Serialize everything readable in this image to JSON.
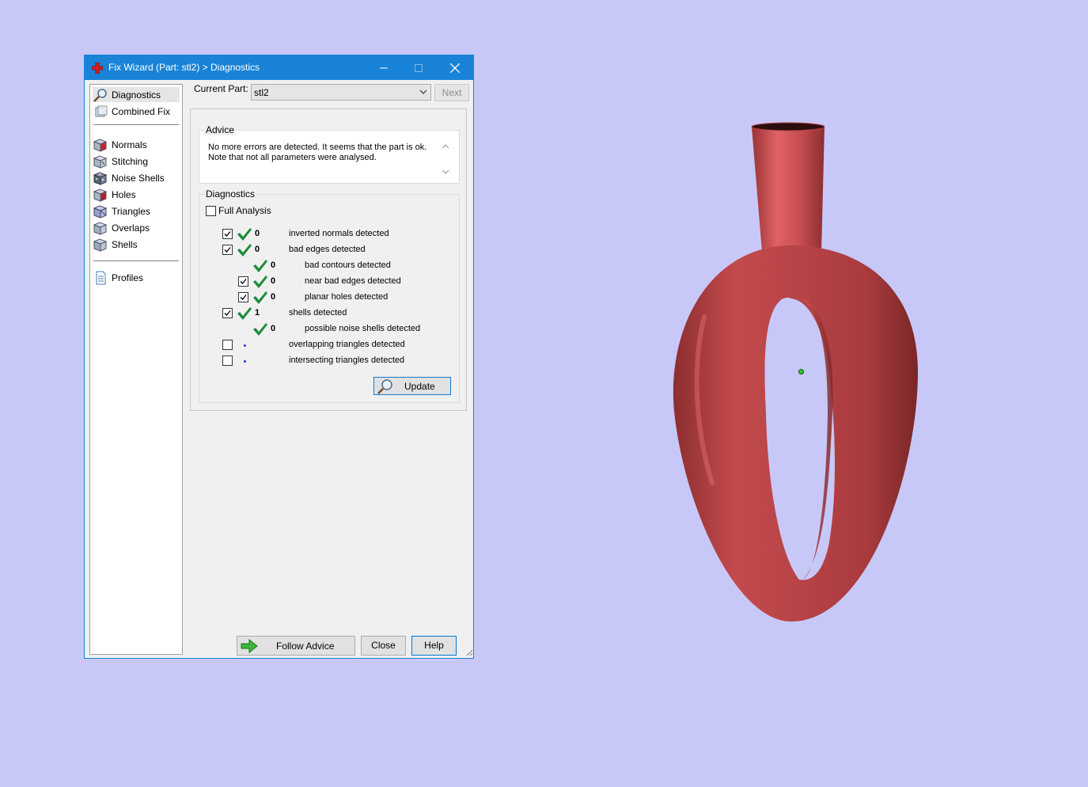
{
  "window": {
    "title": "Fix Wizard (Part: stl2) > Diagnostics",
    "accent_color": "#1883d7",
    "icons": [
      "app-cross-icon",
      "minimize-icon",
      "maximize-icon",
      "close-icon"
    ]
  },
  "sidebar": {
    "items": [
      {
        "label": "Diagnostics",
        "icon": "magnifier-icon",
        "selected": true
      },
      {
        "label": "Combined Fix",
        "icon": "cube-stack-icon"
      },
      {
        "label": "Normals",
        "icon": "normals-cube-icon"
      },
      {
        "label": "Stitching",
        "icon": "stitching-cube-icon"
      },
      {
        "label": "Noise Shells",
        "icon": "noise-shells-icon"
      },
      {
        "label": "Holes",
        "icon": "holes-cube-icon"
      },
      {
        "label": "Triangles",
        "icon": "triangles-cube-icon"
      },
      {
        "label": "Overlaps",
        "icon": "overlaps-cube-icon"
      },
      {
        "label": "Shells",
        "icon": "shells-cube-icon"
      },
      {
        "label": "Profiles",
        "icon": "document-icon"
      }
    ]
  },
  "current_part": {
    "label": "Current Part:",
    "value": "stl2",
    "next_label": "Next"
  },
  "advice": {
    "title": "Advice",
    "line1": "No more errors are detected. It seems that the part is ok.",
    "line2": "Note that not all parameters were analysed."
  },
  "diagnostics": {
    "title": "Diagnostics",
    "full_analysis_label": "Full Analysis",
    "full_analysis_checked": false,
    "rows": [
      {
        "checkbox": true,
        "checked": true,
        "status": "ok",
        "count": "0",
        "label": "inverted normals detected",
        "indent": 0
      },
      {
        "checkbox": true,
        "checked": true,
        "status": "ok",
        "count": "0",
        "label": "bad edges detected",
        "indent": 0
      },
      {
        "checkbox": false,
        "checked": false,
        "status": "ok",
        "count": "0",
        "label": "bad contours detected",
        "indent": 1
      },
      {
        "checkbox": true,
        "checked": true,
        "status": "ok",
        "count": "0",
        "label": "near bad edges detected",
        "indent": 1
      },
      {
        "checkbox": true,
        "checked": true,
        "status": "ok",
        "count": "0",
        "label": "planar holes detected",
        "indent": 1
      },
      {
        "checkbox": true,
        "checked": true,
        "status": "ok",
        "count": "1",
        "label": "shells detected",
        "indent": 0
      },
      {
        "checkbox": false,
        "checked": false,
        "status": "ok",
        "count": "0",
        "label": "possible noise shells detected",
        "indent": 1
      },
      {
        "checkbox": true,
        "checked": false,
        "status": "pending",
        "count": "",
        "label": "overlapping triangles detected",
        "indent": 0
      },
      {
        "checkbox": true,
        "checked": false,
        "status": "pending",
        "count": "",
        "label": "intersecting triangles detected",
        "indent": 0
      }
    ],
    "update_label": "Update"
  },
  "footer": {
    "follow_advice_label": "Follow Advice",
    "close_label": "Close",
    "help_label": "Help"
  },
  "viewport": {
    "background": "#c8c8f8",
    "model_color": "#c8484c",
    "pivot_color": "#2ecc2e"
  }
}
